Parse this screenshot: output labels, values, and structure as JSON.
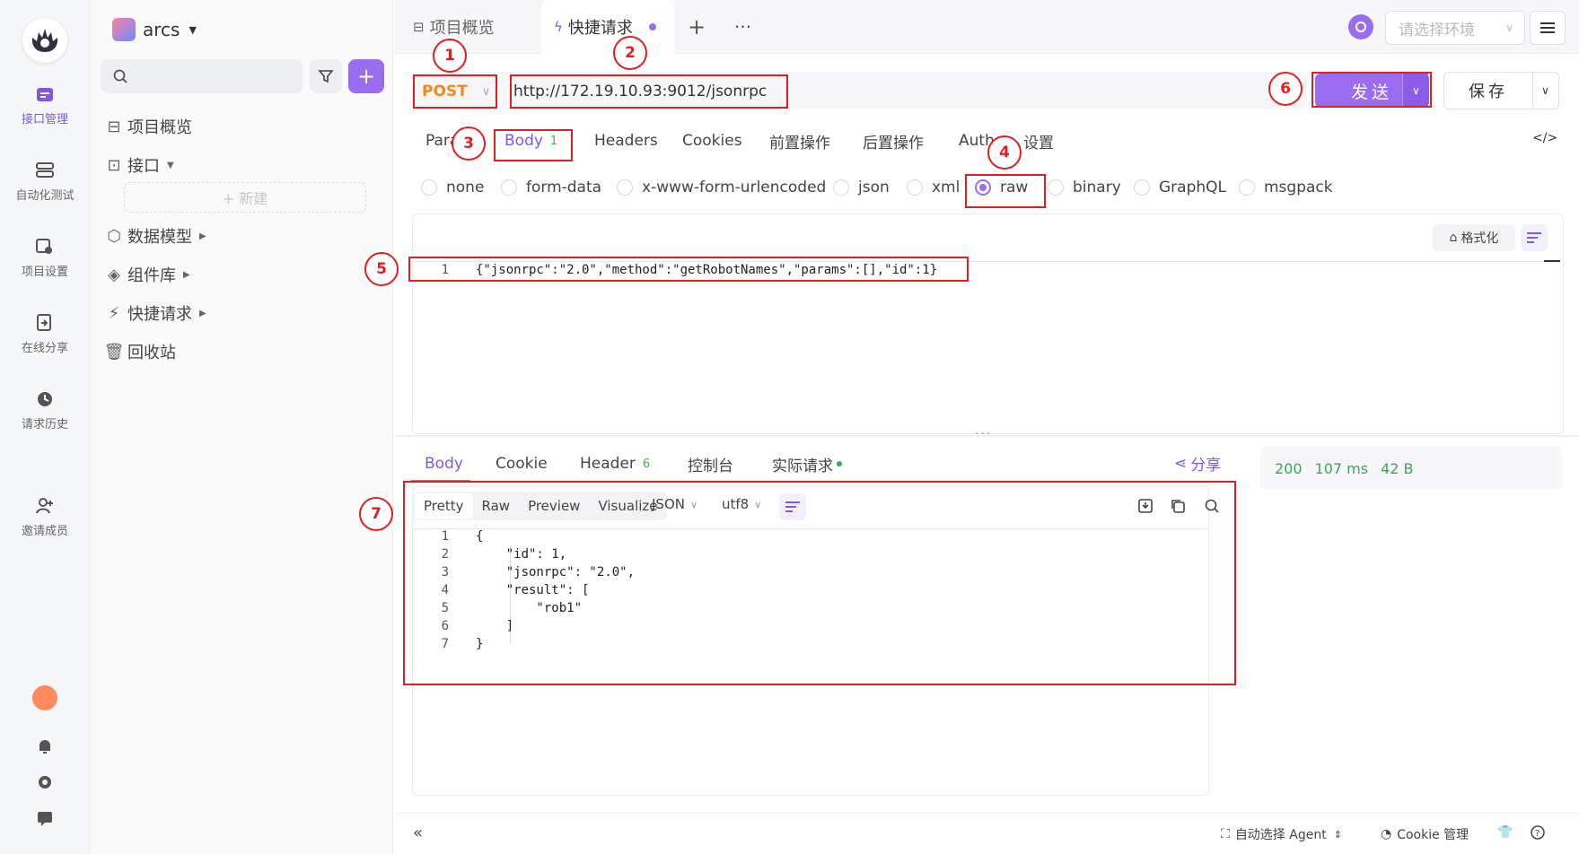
{
  "rail": {
    "items": [
      {
        "label": "接口管理",
        "icon": "api-icon",
        "active": true
      },
      {
        "label": "自动化测试",
        "icon": "automation-icon"
      },
      {
        "label": "项目设置",
        "icon": "settings-project-icon"
      },
      {
        "label": "在线分享",
        "icon": "share-doc-icon"
      },
      {
        "label": "请求历史",
        "icon": "history-icon"
      },
      {
        "label": "邀请成员",
        "icon": "invite-user-icon"
      }
    ]
  },
  "sidebar": {
    "project_name": "arcs",
    "new_label": "+ 新建",
    "tree": [
      {
        "label": "项目概览",
        "icon": "overview-icon"
      },
      {
        "label": "接口",
        "icon": "api-folder-icon"
      },
      {
        "label": "数据模型",
        "icon": "data-model-icon"
      },
      {
        "label": "组件库",
        "icon": "component-icon"
      },
      {
        "label": "快捷请求",
        "icon": "quick-request-icon"
      },
      {
        "label": "回收站",
        "icon": "trash-icon"
      }
    ]
  },
  "tabs": {
    "overview": "项目概览",
    "quick": "快捷请求",
    "env_placeholder": "请选择环境"
  },
  "request": {
    "method": "POST",
    "url": "http://172.19.10.93:9012/jsonrpc",
    "send_label": "发送",
    "save_label": "保存",
    "tabs": [
      {
        "label": "Para"
      },
      {
        "label": "Body",
        "badge": "1",
        "active": true
      },
      {
        "label": "Headers"
      },
      {
        "label": "Cookies"
      },
      {
        "label": "前置操作"
      },
      {
        "label": "后置操作"
      },
      {
        "label": "Auth"
      },
      {
        "label": "设置"
      }
    ],
    "body_types": [
      "none",
      "form-data",
      "x-www-form-urlencoded",
      "json",
      "xml",
      "raw",
      "binary",
      "GraphQL",
      "msgpack"
    ],
    "body_type_selected": "raw",
    "format_label": "格式化",
    "code_toggle": "</>",
    "body_line_no": "1",
    "body": "{\"jsonrpc\":\"2.0\",\"method\":\"getRobotNames\",\"params\":[],\"id\":1}"
  },
  "response": {
    "tabs": [
      {
        "label": "Body",
        "active": true
      },
      {
        "label": "Cookie"
      },
      {
        "label": "Header",
        "badge": "6"
      },
      {
        "label": "控制台"
      },
      {
        "label": "实际请求"
      }
    ],
    "share_label": "分享",
    "status": "200",
    "time": "107 ms",
    "size": "42 B",
    "views": [
      "Pretty",
      "Raw",
      "Preview",
      "Visualize"
    ],
    "format": "JSON",
    "encoding": "utf8",
    "lines": [
      {
        "n": "1",
        "text": "{"
      },
      {
        "n": "2",
        "text": "    \"id\": 1,"
      },
      {
        "n": "3",
        "text": "    \"jsonrpc\": \"2.0\","
      },
      {
        "n": "4",
        "text": "    \"result\": ["
      },
      {
        "n": "5",
        "text": "        \"rob1\""
      },
      {
        "n": "6",
        "text": "    ]"
      },
      {
        "n": "7",
        "text": "}"
      }
    ]
  },
  "footer": {
    "agent": "自动选择 Agent",
    "cookie": "Cookie 管理"
  },
  "annotations": [
    "1",
    "2",
    "3",
    "4",
    "5",
    "6",
    "7"
  ],
  "colors": {
    "accent": "#9a6cf0",
    "method": "#f08a24",
    "annotation": "#e02020",
    "status_ok": "#3aa757"
  }
}
